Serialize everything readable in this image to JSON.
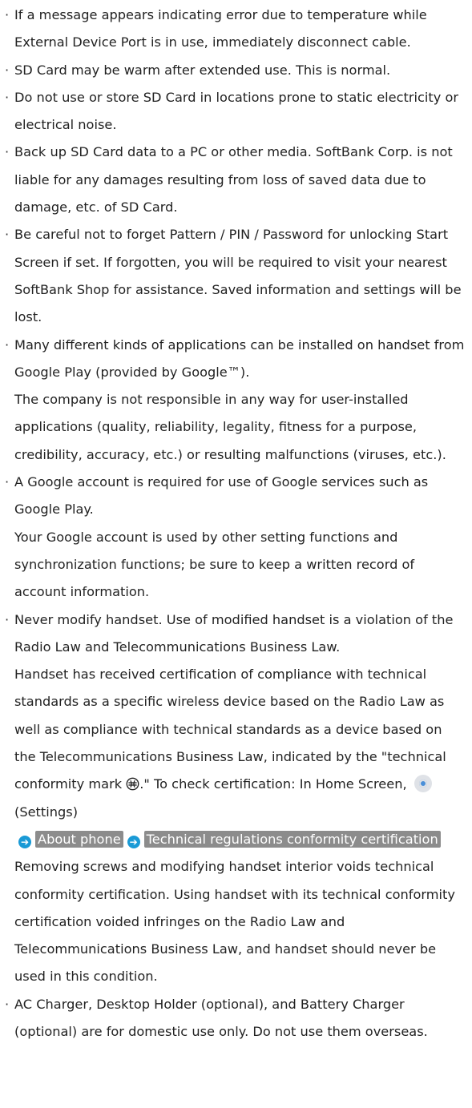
{
  "bullet_char": "·",
  "items": [
    {
      "paragraphs": [
        "If a message appears indicating error due to temperature while External Device Port is in use, immediately disconnect cable."
      ]
    },
    {
      "paragraphs": [
        "SD Card may be warm after extended use. This is normal."
      ]
    },
    {
      "paragraphs": [
        "Do not use or store SD Card in locations prone to static electricity or electrical noise."
      ]
    },
    {
      "paragraphs": [
        "Back up SD Card data to a PC or other media. SoftBank Corp. is not liable for any damages resulting from loss of saved data due to damage, etc. of SD Card."
      ]
    },
    {
      "paragraphs": [
        "Be careful not to forget Pattern / PIN / Password for unlocking Start Screen if set. If forgotten, you will be required to visit your nearest SoftBank Shop for assistance. Saved information and settings will be lost."
      ]
    },
    {
      "paragraphs": [
        "Many different kinds of applications can be installed on handset from Google Play (provided by Google™).",
        "The company is not responsible in any way for user-installed applications (quality, reliability, legality, fitness for a purpose, credibility, accuracy, etc.) or resulting malfunctions (viruses, etc.)."
      ]
    },
    {
      "paragraphs": [
        "A Google account is required for use of Google services such as Google Play.",
        "Your Google account is used by other setting functions and synchronization functions; be sure to keep a written record of account information."
      ]
    }
  ],
  "modify_item": {
    "p1": "Never modify handset. Use of modified handset is a violation of the Radio Law and Telecommunications Business Law.",
    "p2_start": "Handset has received certification of compliance with technical standards as a specific wireless device based on the Radio Law as well as compliance with technical standards as a device based on the Telecommunications Business Law, indicated by the \"technical conformity mark ",
    "p2_mid": ".\" To check certification: In Home Screen, ",
    "settings_label": "(Settings)",
    "chip_about": "About phone",
    "chip_cert": "Technical regulations conformity certification",
    "p3": "Removing screws and modifying handset interior voids technical conformity certification. Using handset with its technical conformity certification voided infringes on the Radio Law and Telecommunications Business Law, and handset should never be used in this condition.",
    "arrow_glyph": "➔"
  },
  "last_item": {
    "paragraphs": [
      "AC Charger, Desktop Holder (optional), and Battery Charger (optional) are for domestic use only. Do not use them overseas."
    ]
  },
  "icons": {
    "technical_mark": "technical-conformity-mark-icon",
    "settings": "settings-icon",
    "arrow": "arrow-right-icon"
  },
  "colors": {
    "chip_bg": "#8c8c8c",
    "arrow_bg": "#1a9ad6",
    "text": "#222222"
  }
}
